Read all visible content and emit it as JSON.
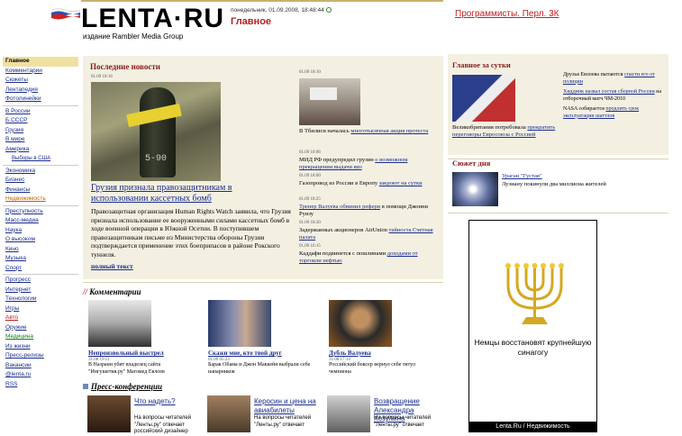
{
  "header": {
    "logo": "LENTA·RU",
    "logo_subtitle": "издание Rambler Media Group",
    "date": "понедельник, 01.09.2008, 18:48:44",
    "section": "Главное",
    "ad_link": "Программисты. Перл. 3К"
  },
  "sidebar": {
    "items": [
      {
        "label": "Главное",
        "style": "active"
      },
      {
        "label": "Комментарии"
      },
      {
        "label": "Сюжеты"
      },
      {
        "label": "Лентапедия"
      },
      {
        "label": "Фотолинейки"
      },
      {
        "sep": true
      },
      {
        "label": "В России"
      },
      {
        "label": "Б.СССР"
      },
      {
        "label": "Грузия"
      },
      {
        "label": "В мире"
      },
      {
        "label": "Америка"
      },
      {
        "label": "Выборы в США",
        "style": "sub"
      },
      {
        "sep": true
      },
      {
        "label": "Экономика"
      },
      {
        "label": "Бизнес"
      },
      {
        "label": "Финансы"
      },
      {
        "label": "Недвижимость",
        "style": "orange"
      },
      {
        "sep": true
      },
      {
        "label": "Преступность"
      },
      {
        "label": "Масс-медиа"
      },
      {
        "label": "Наука"
      },
      {
        "label": "О высоком"
      },
      {
        "label": "Кино"
      },
      {
        "label": "Музыка"
      },
      {
        "label": "Спорт"
      },
      {
        "sep": true
      },
      {
        "label": "Прогресс"
      },
      {
        "label": "Интернет"
      },
      {
        "label": "Технологии"
      },
      {
        "label": "Игры"
      },
      {
        "label": "Авто",
        "style": "red"
      },
      {
        "label": "Оружие"
      },
      {
        "label": "Медицина",
        "style": "green"
      },
      {
        "label": "Из жизни"
      },
      {
        "label": "Пресс-релизы"
      },
      {
        "label": "Вакансии"
      },
      {
        "label": "@lenta.ru"
      },
      {
        "label": "RSS"
      }
    ]
  },
  "latest": {
    "title": "Последние новости",
    "main_time": "01.09 18:16",
    "main_headline": "Грузия признала правозащитникам в использовании кассетных бомб",
    "main_lead": "Правозащитная организация Human Rights Watch заявила, что Грузия признала использование ее вооруженными силами кассетных бомб в ходе военной операции в Южной Осетии. В поступившем правозащитникам письме из Министерства обороны Грузии подтверждается применение этих боеприпасов в районе Рокского туннеля.",
    "full_text": "полный текст",
    "photo_label": "5-90",
    "right_items": [
      {
        "time": "01.09 18:10",
        "text": "В Тбилиси началась ",
        "link": "многотысячная акция протеста"
      },
      {
        "time": "01.09 18:06",
        "text": "МИД РФ предупредил грузин ",
        "link": "о возможном прекращении выдачи виз"
      },
      {
        "time": "01.09 18:00",
        "text": "Газопровод из России в Европу ",
        "link": "закроют на сутки"
      },
      {
        "time": "01.09 18:25",
        "text": "",
        "link": "Тренер Валуева обвинил рефери",
        "tail": " в помощи Джонни Руизу"
      },
      {
        "time": "01.09 18:30",
        "text": "Задержанных акционеров AirUnion ",
        "link": "тайноста Счетная палата"
      },
      {
        "time": "01.09 16:15",
        "text": "Каддафи подвинется с пошлинами ",
        "link": "доходами от торговли нефтью"
      }
    ]
  },
  "comments": {
    "title": "Комментарии",
    "items": [
      {
        "title": "Непроизвольный выстрел",
        "time": "31.08 19:51",
        "desc": "В Назрани убит владелец сайта \"Ингушетия.ру\" Магомед Евлоев"
      },
      {
        "title": "Скажи мне, кто твой друг",
        "time": "01.09 05:23",
        "desc": "Барак Обама и Джон Маккейн выбрали себе напарников"
      },
      {
        "title": "Дубль Валуева",
        "time": "31.08 17:14",
        "desc": "Российский боксер вернул себе титул чемпиона"
      }
    ]
  },
  "press": {
    "title": "Пресс-конференции",
    "items": [
      {
        "title": "Что надеть?",
        "desc": "На вопросы читателей \"Ленты.ру\" отвечает российский дизайнер"
      },
      {
        "title": "Керосин и цена на авиабилеты",
        "desc": "На вопросы читателей \"Ленты.ру\" отвечает"
      },
      {
        "title": "Возвращение Александра Козулина",
        "desc": "На вопросы читателей \"Ленты.ру\" отвечает"
      }
    ]
  },
  "day_main": {
    "title": "Главное за сутки",
    "caption_text": "Великобритания потребовала ",
    "caption_link": "прекратить переговоры Евросоюза с Россией",
    "list": [
      {
        "text": "Друзья Евлоева пытаются ",
        "link": "спасти его от полиции"
      },
      {
        "text": "",
        "link": "Хиддинк назвал состав сборной России",
        "tail": " на отборочный матч ЧМ-2010"
      },
      {
        "text": "NASA собирается ",
        "link": "продлить срок эксплуатации шаттлов"
      }
    ]
  },
  "plot": {
    "title": "Сюжет дня",
    "link": "Ураган \"Густав\"",
    "desc": "Лузиану покинули два миллиона жителей"
  },
  "ad": {
    "text": "Немцы восстановят крупнейшую синагогу",
    "footer": "Lenta.Ru / Недвижимость"
  }
}
